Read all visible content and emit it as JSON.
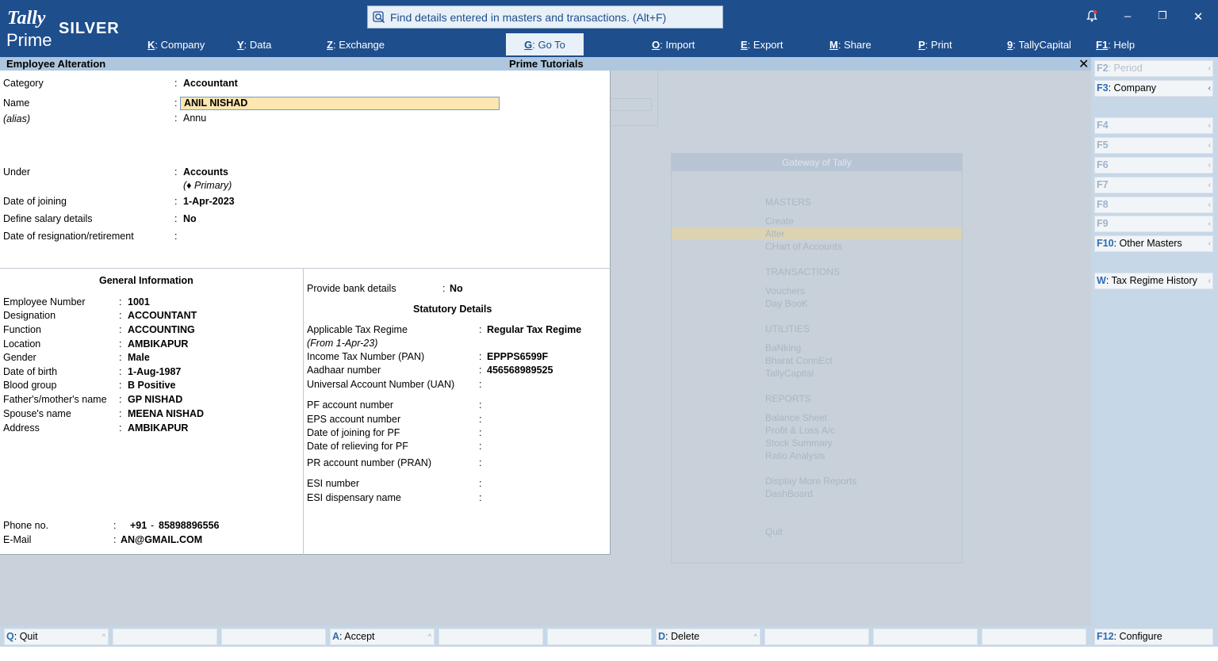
{
  "app": {
    "logo_line1": "Tally",
    "logo_line2": "Prime",
    "edition": "SILVER"
  },
  "search": {
    "placeholder": "Find details entered in masters and transactions. (Alt+F)"
  },
  "menu": [
    {
      "key": "K",
      "label": "Company"
    },
    {
      "key": "Y",
      "label": "Data"
    },
    {
      "key": "Z",
      "label": "Exchange"
    },
    {
      "key": "G",
      "label": "Go To"
    },
    {
      "key": "O",
      "label": "Import"
    },
    {
      "key": "E",
      "label": "Export"
    },
    {
      "key": "M",
      "label": "Share"
    },
    {
      "key": "P",
      "label": "Print"
    },
    {
      "key": "9",
      "label": "TallyCapital"
    },
    {
      "key": "F1",
      "label": "Help"
    }
  ],
  "window": {
    "title": "Employee Alteration",
    "center_title": "Prime Tutorials",
    "close": "✕"
  },
  "form": {
    "category": {
      "label": "Category",
      "value": "Accountant"
    },
    "name": {
      "label": "Name",
      "value": "ANIL NISHAD"
    },
    "alias": {
      "label": "(alias)",
      "value": "Annu"
    },
    "under": {
      "label": "Under",
      "value": "Accounts",
      "sub": "(♦ Primary)"
    },
    "doj": {
      "label": "Date of joining",
      "value": "1-Apr-2023"
    },
    "salary": {
      "label": "Define salary details",
      "value": "No"
    },
    "resign": {
      "label": "Date of resignation/retirement",
      "value": ""
    }
  },
  "general": {
    "heading": "General Information",
    "fields": [
      {
        "label": "Employee Number",
        "value": "1001"
      },
      {
        "label": "Designation",
        "value": "ACCOUNTANT"
      },
      {
        "label": "Function",
        "value": "ACCOUNTING"
      },
      {
        "label": "Location",
        "value": "AMBIKAPUR"
      },
      {
        "label": "Gender",
        "value": "Male"
      },
      {
        "label": "Date of birth",
        "value": "1-Aug-1987"
      },
      {
        "label": "Blood group",
        "value": "B Positive"
      },
      {
        "label": "Father's/mother's name",
        "value": "GP NISHAD"
      },
      {
        "label": "Spouse's name",
        "value": "MEENA NISHAD"
      },
      {
        "label": "Address",
        "value": "AMBIKAPUR"
      }
    ],
    "phone": {
      "label": "Phone no.",
      "code": "+91",
      "sep": "-",
      "number": "85898896556"
    },
    "email": {
      "label": "E-Mail",
      "value": "AN@GMAIL.COM"
    }
  },
  "statutory": {
    "bank": {
      "label": "Provide bank details",
      "value": "No"
    },
    "heading": "Statutory Details",
    "regime": {
      "label": "Applicable Tax Regime",
      "value": "Regular Tax Regime",
      "sub": "(From 1-Apr-23)"
    },
    "pan": {
      "label": "Income Tax Number (PAN)",
      "value": "EPPPS6599F"
    },
    "aadhaar": {
      "label": "Aadhaar number",
      "value": "456568989525"
    },
    "uan": {
      "label": "Universal Account Number (UAN)",
      "value": ""
    },
    "pf": {
      "label": "PF account number",
      "value": ""
    },
    "eps": {
      "label": "EPS account number",
      "value": ""
    },
    "pfjoin": {
      "label": "Date of joining for PF",
      "value": ""
    },
    "pfrel": {
      "label": "Date of relieving for PF",
      "value": ""
    },
    "pran": {
      "label": "PR account number (PRAN)",
      "value": ""
    },
    "esi": {
      "label": "ESI number",
      "value": ""
    },
    "esid": {
      "label": "ESI dispensary name",
      "value": ""
    }
  },
  "colon": ":",
  "gateway": {
    "title": "Gateway of Tally",
    "items": [
      "MASTERS",
      "Create",
      "Alter",
      "CHart of Accounts",
      "TRANSACTIONS",
      "Vouchers",
      "Day BooK",
      "UTILITIES",
      "BaNking",
      "Bharat ConnEct",
      "TallyCapital",
      "REPORTS",
      "Balance Sheet",
      "Profit & Loss A/c",
      "Stock Summary",
      "Ratio Analysis",
      "Display More Reports",
      "DashBoard",
      "Quit"
    ]
  },
  "right_buttons": [
    {
      "key": "F2",
      "label": "Period",
      "enabled": false
    },
    {
      "key": "F3",
      "label": "Company",
      "enabled": true
    },
    {
      "key": "F4",
      "label": "",
      "enabled": false
    },
    {
      "key": "F5",
      "label": "",
      "enabled": false
    },
    {
      "key": "F6",
      "label": "",
      "enabled": false
    },
    {
      "key": "F7",
      "label": "",
      "enabled": false
    },
    {
      "key": "F8",
      "label": "",
      "enabled": false
    },
    {
      "key": "F9",
      "label": "",
      "enabled": false
    },
    {
      "key": "F10",
      "label": "Other Masters",
      "enabled": true
    },
    {
      "key": "W",
      "label": "Tax Regime History",
      "enabled": true
    }
  ],
  "bottom_buttons": [
    {
      "key": "Q",
      "label": "Quit"
    },
    {
      "key": "",
      "label": ""
    },
    {
      "key": "",
      "label": ""
    },
    {
      "key": "A",
      "label": "Accept"
    },
    {
      "key": "",
      "label": ""
    },
    {
      "key": "",
      "label": ""
    },
    {
      "key": "D",
      "label": "Delete"
    },
    {
      "key": "",
      "label": ""
    },
    {
      "key": "",
      "label": ""
    },
    {
      "key": "",
      "label": ""
    }
  ],
  "f12": {
    "key": "F12",
    "label": "Configure"
  },
  "colors": {
    "header": "#1f4e8c",
    "panel": "#c6d7e8",
    "highlight": "#fde6b0",
    "key": "#2a6cb0"
  }
}
